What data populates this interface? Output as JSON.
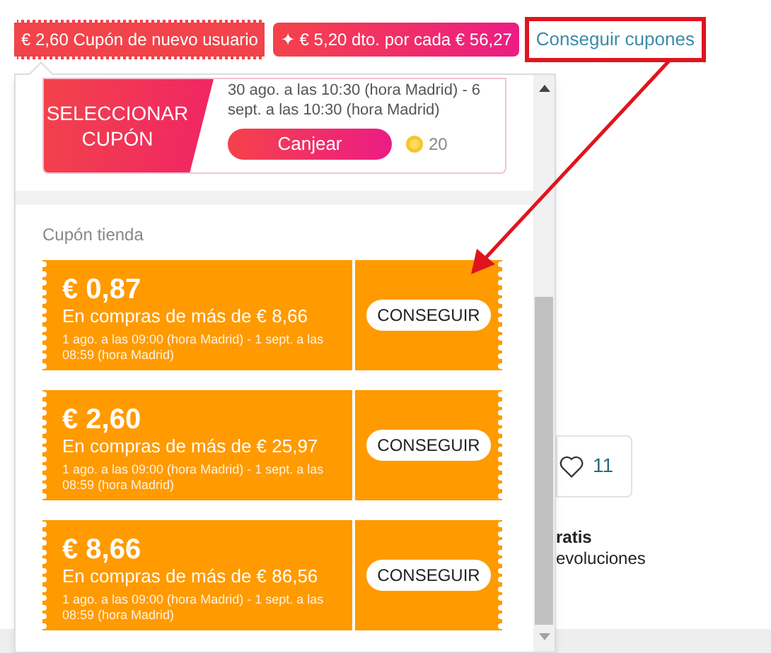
{
  "tags": [
    {
      "kind": "coupon",
      "text": "€ 2,60 Cupón de nuevo usuario"
    },
    {
      "kind": "promo",
      "text": "✦ € 5,20 dto. por cada € 56,27"
    }
  ],
  "get_coupons_link": "Conseguir cupones",
  "popup": {
    "platform_coupon": {
      "label": "SELECCIONAR CUPÓN",
      "validity": "30 ago. a las 10:30 (hora Madrid) - 6 sept. a las 10:30 (hora Madrid)",
      "button": "Canjear",
      "coins": "20"
    },
    "section_title": "Cupón tienda",
    "coupons": [
      {
        "amount": "€ 0,87",
        "condition": "En compras de más de € 8,66",
        "validity": "1 ago. a las 09:00 (hora Madrid) - 1 sept. a las 08:59 (hora Madrid)",
        "button": "CONSEGUIR"
      },
      {
        "amount": "€ 2,60",
        "condition": "En compras de más de € 25,97",
        "validity": "1 ago. a las 09:00 (hora Madrid) - 1 sept. a las 08:59 (hora Madrid)",
        "button": "CONSEGUIR"
      },
      {
        "amount": "€ 8,66",
        "condition": "En compras de más de € 86,56",
        "validity": "1 ago. a las 09:00 (hora Madrid) - 1 sept. a las 08:59 (hora Madrid)",
        "button": "CONSEGUIR"
      }
    ]
  },
  "background": {
    "like_count": "11",
    "text_1": "ratis",
    "text_2": "evoluciones"
  }
}
